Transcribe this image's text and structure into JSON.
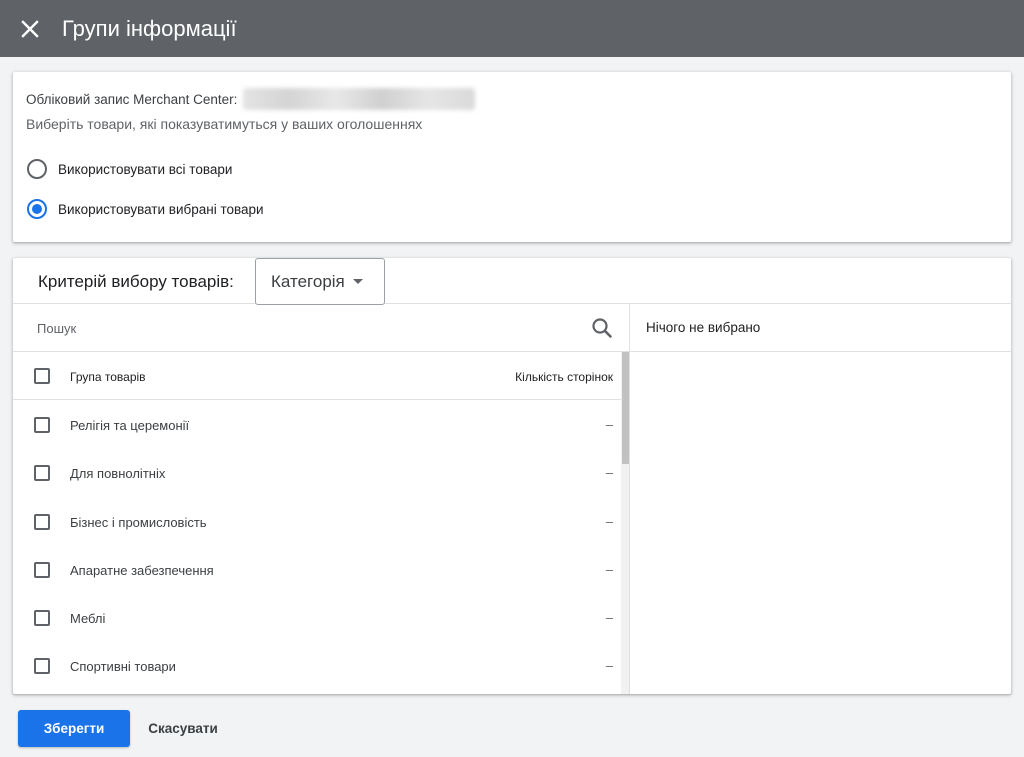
{
  "header": {
    "title": "Групи інформації",
    "close_icon": "close-icon"
  },
  "account": {
    "label": "Обліковий запис Merchant Center:",
    "subtitle": "Виберіть товари, які показуватимуться у ваших оголошеннях"
  },
  "options": {
    "all_products": {
      "label": "Використовувати всі товари",
      "selected": false
    },
    "selected_products": {
      "label": "Використовувати вибрані товари",
      "selected": true
    }
  },
  "criteria": {
    "label": "Критерій вибору товарів:",
    "selected": "Категорія"
  },
  "search": {
    "placeholder": "Пошук",
    "icon": "search-icon"
  },
  "table": {
    "col_name": "Група товарів",
    "col_count": "Кількість сторінок",
    "rows": [
      {
        "name": "Релігія та церемонії",
        "count": "–"
      },
      {
        "name": "Для повнолітніх",
        "count": "–"
      },
      {
        "name": "Бізнес і промисловість",
        "count": "–"
      },
      {
        "name": "Апаратне забезпечення",
        "count": "–"
      },
      {
        "name": "Меблі",
        "count": "–"
      },
      {
        "name": "Спортивні товари",
        "count": "–"
      }
    ]
  },
  "selection": {
    "empty_text": "Нічого не вибрано"
  },
  "actions": {
    "save": "Зберегти",
    "cancel": "Скасувати"
  },
  "colors": {
    "topbar": "#5f6368",
    "accent": "#1a73e8",
    "background": "#f1f3f4"
  }
}
